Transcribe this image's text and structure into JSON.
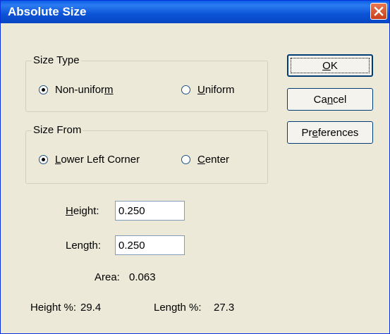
{
  "window": {
    "title": "Absolute Size"
  },
  "size_type": {
    "legend": "Size Type",
    "options": [
      {
        "pre": "Non-unifor",
        "ul": "m",
        "post": "",
        "selected": true
      },
      {
        "pre": "",
        "ul": "U",
        "post": "niform",
        "selected": false
      }
    ]
  },
  "size_from": {
    "legend": "Size From",
    "options": [
      {
        "pre": "",
        "ul": "L",
        "post": "ower Left Corner",
        "selected": true
      },
      {
        "pre": "",
        "ul": "C",
        "post": "enter",
        "selected": false
      }
    ]
  },
  "buttons": {
    "ok": {
      "pre": "",
      "ul": "O",
      "post": "K"
    },
    "cancel": {
      "pre": "Ca",
      "ul": "n",
      "post": "cel"
    },
    "preferences": {
      "pre": "Pr",
      "ul": "e",
      "post": "ferences"
    }
  },
  "fields": {
    "height": {
      "pre": "",
      "ul": "H",
      "post": "eight:",
      "value": "0.250"
    },
    "length": {
      "pre": "Length:",
      "ul": "",
      "post": "",
      "value": "0.250"
    }
  },
  "stats": {
    "area_label": "Area:",
    "area_value": "0.063",
    "height_pct_label": "Height %:",
    "height_pct_value": "29.4",
    "length_pct_label": "Length %:",
    "length_pct_value": "27.3"
  }
}
